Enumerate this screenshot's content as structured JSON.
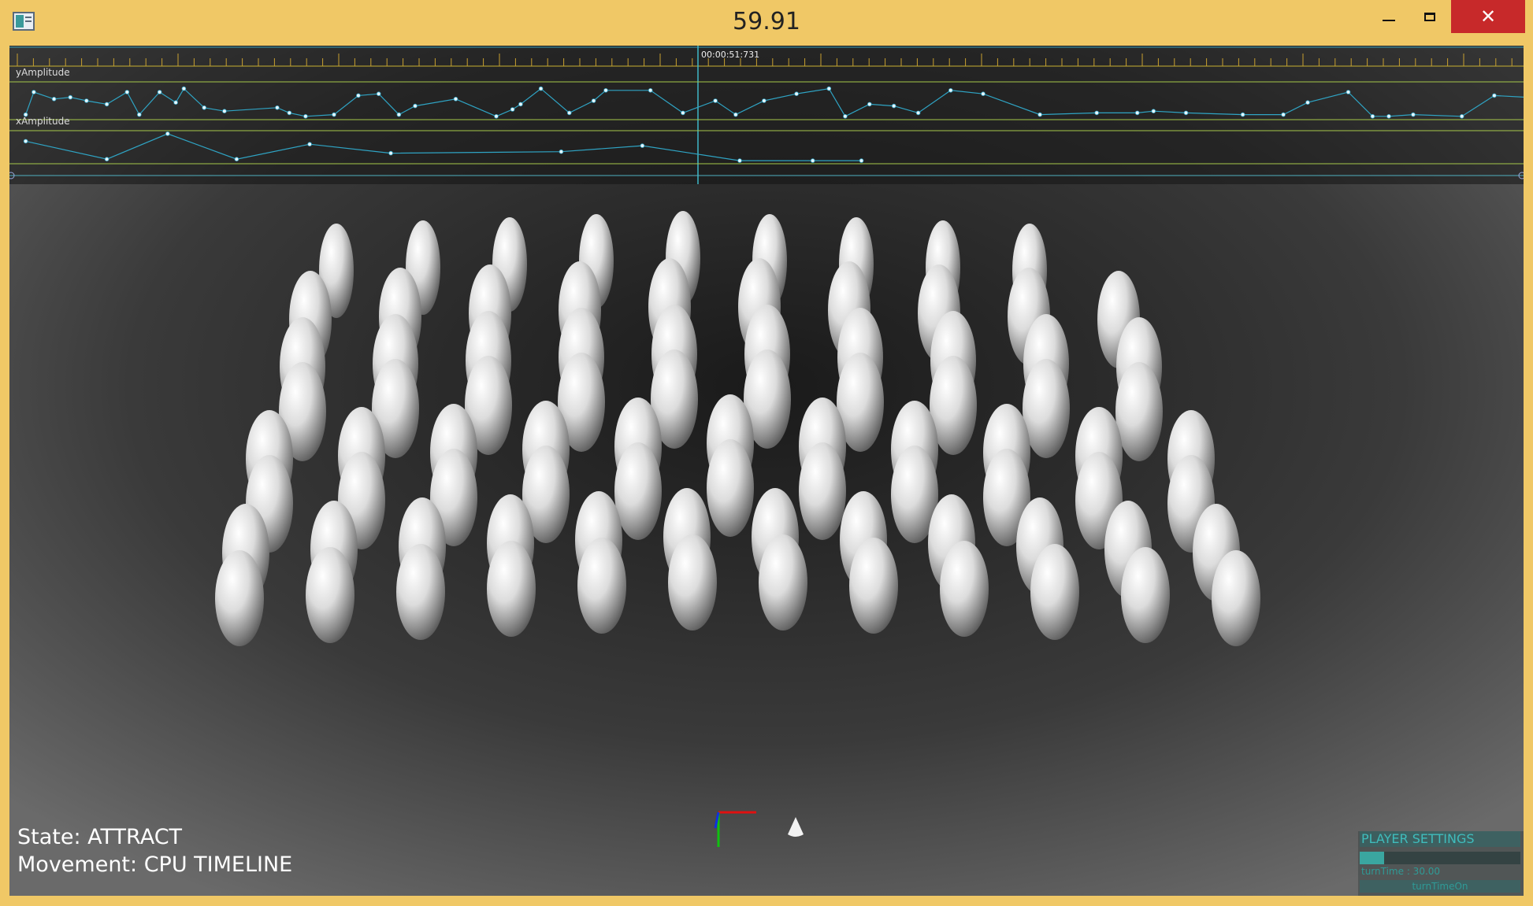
{
  "window": {
    "title": "59.91",
    "minimize_icon": "minimize-icon",
    "maximize_icon": "maximize-icon",
    "close_icon": "close-icon",
    "close_glyph": "✕"
  },
  "timeline": {
    "playhead_time": "00:00:51:731",
    "tracks": [
      {
        "label": "yAmplitude",
        "keyframes": [
          [
            0.02,
            0.1
          ],
          [
            0.03,
            0.75
          ],
          [
            0.055,
            0.55
          ],
          [
            0.075,
            0.6
          ],
          [
            0.095,
            0.5
          ],
          [
            0.12,
            0.4
          ],
          [
            0.145,
            0.75
          ],
          [
            0.16,
            0.1
          ],
          [
            0.185,
            0.75
          ],
          [
            0.205,
            0.45
          ],
          [
            0.215,
            0.85
          ],
          [
            0.24,
            0.3
          ],
          [
            0.265,
            0.2
          ],
          [
            0.33,
            0.3
          ],
          [
            0.345,
            0.15
          ],
          [
            0.365,
            0.05
          ],
          [
            0.4,
            0.1
          ],
          [
            0.43,
            0.65
          ],
          [
            0.455,
            0.7
          ],
          [
            0.48,
            0.1
          ],
          [
            0.5,
            0.35
          ],
          [
            0.55,
            0.55
          ],
          [
            0.6,
            0.05
          ],
          [
            0.62,
            0.25
          ],
          [
            0.63,
            0.4
          ],
          [
            0.655,
            0.85
          ],
          [
            0.69,
            0.15
          ],
          [
            0.72,
            0.5
          ],
          [
            0.735,
            0.8
          ],
          [
            0.79,
            0.8
          ],
          [
            0.83,
            0.15
          ],
          [
            0.87,
            0.5
          ],
          [
            0.895,
            0.1
          ],
          [
            0.93,
            0.5
          ],
          [
            0.97,
            0.7
          ],
          [
            1.01,
            0.85
          ],
          [
            1.03,
            0.05
          ],
          [
            1.06,
            0.4
          ],
          [
            1.09,
            0.35
          ],
          [
            1.12,
            0.15
          ],
          [
            1.16,
            0.8
          ],
          [
            1.2,
            0.7
          ],
          [
            1.27,
            0.1
          ],
          [
            1.34,
            0.15
          ],
          [
            1.39,
            0.15
          ],
          [
            1.41,
            0.2
          ],
          [
            1.45,
            0.15
          ],
          [
            1.52,
            0.1
          ],
          [
            1.57,
            0.1
          ],
          [
            1.6,
            0.45
          ],
          [
            1.65,
            0.75
          ],
          [
            1.68,
            0.05
          ],
          [
            1.7,
            0.05
          ],
          [
            1.73,
            0.1
          ],
          [
            1.79,
            0.05
          ],
          [
            1.83,
            0.65
          ],
          [
            1.87,
            0.6
          ]
        ]
      },
      {
        "label": "xAmplitude",
        "keyframes": [
          [
            0.02,
            0.7
          ],
          [
            0.12,
            0.1
          ],
          [
            0.195,
            0.95
          ],
          [
            0.28,
            0.1
          ],
          [
            0.37,
            0.6
          ],
          [
            0.47,
            0.3
          ],
          [
            0.68,
            0.35
          ],
          [
            0.78,
            0.55
          ],
          [
            0.9,
            0.05
          ],
          [
            0.99,
            0.05
          ],
          [
            1.05,
            0.05
          ]
        ]
      }
    ]
  },
  "scene": {
    "axis_gizmo": "axis-gizmo-icon",
    "cursor": "cone-icon"
  },
  "hud": {
    "state": "State: ATTRACT",
    "movement": "Movement: CPU TIMELINE"
  },
  "player_settings": {
    "title": "PLAYER SETTINGS",
    "turn_time": "turnTime : 30.00",
    "turn_time_fraction": 0.15,
    "toggle": "turnTimeOn"
  }
}
